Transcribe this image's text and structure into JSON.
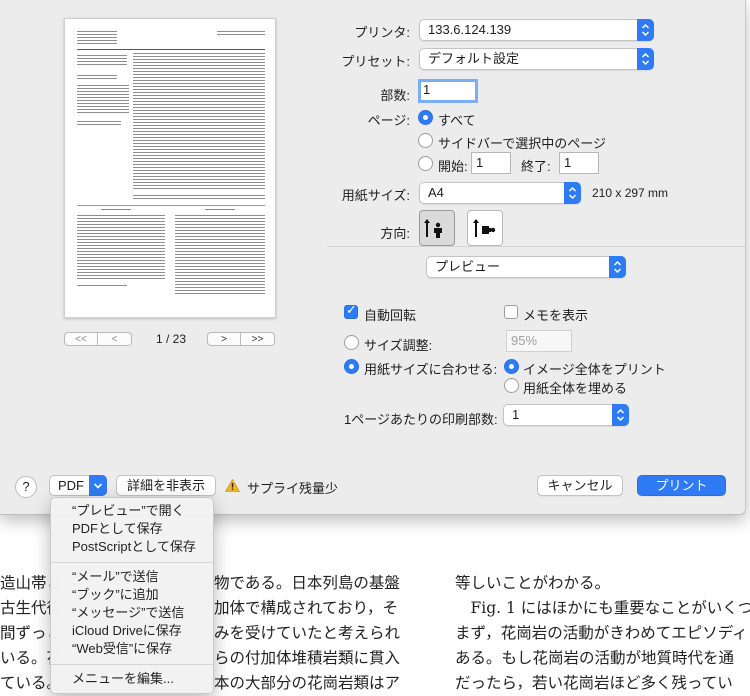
{
  "preview": {
    "page_indicator": "1 / 23",
    "nav_first": "<<",
    "nav_prev": "<",
    "nav_next": ">",
    "nav_last": ">>"
  },
  "printer": {
    "label": "プリンタ:",
    "value": "133.6.124.139"
  },
  "preset": {
    "label": "プリセット:",
    "value": "デフォルト設定"
  },
  "copies": {
    "label": "部数:",
    "value": "1"
  },
  "pages": {
    "label": "ページ:",
    "all": "すべて",
    "sidebar": "サイドバーで選択中のページ",
    "from_label": "開始:",
    "from_value": "1",
    "to_label": "終了:",
    "to_value": "1"
  },
  "paper": {
    "label": "用紙サイズ:",
    "value": "A4",
    "dims": "210 x 297 mm"
  },
  "orientation": {
    "label": "方向:"
  },
  "section": {
    "value": "プレビュー"
  },
  "options": {
    "auto_rotate": "自動回転",
    "show_notes": "メモを表示",
    "scale_label": "サイズ調整:",
    "scale_value": "95%",
    "fit_label": "用紙サイズに合わせる:",
    "print_entire": "イメージ全体をプリント",
    "fill_paper": "用紙全体を埋める",
    "per_page_label": "1ページあたりの印刷部数:",
    "per_page_value": "1"
  },
  "footer": {
    "help": "?",
    "pdf": "PDF",
    "hide_details": "詳細を非表示",
    "supply_warning": "サプライ残量少",
    "cancel": "キャンセル",
    "print": "プリント"
  },
  "pdf_menu": {
    "group1": [
      "“プレビュー”で開く",
      "PDFとして保存",
      "PostScriptとして保存"
    ],
    "group2": [
      "“メール”で送信",
      "“ブック”に追加",
      "“メッセージ”で送信",
      "iCloud Driveに保存",
      "“Web受信”に保存"
    ],
    "group3": [
      "メニューを編集..."
    ]
  },
  "background_doc": {
    "left_lines": [
      "造山帯と",
      "古生代後",
      "間ずっと",
      "いる。花",
      "ている。"
    ],
    "left_lines2": [
      "物である。日本列島の基盤",
      "加体で構成されており，そ",
      "みを受けていたと考えられ",
      "らの付加体堆積岩類に貫入",
      "本の大部分の花崗岩類はア"
    ],
    "right_lines": [
      "等しいことがわかる。",
      "　Fig. 1 にはほかにも重要なことがいくつ",
      "まず，花崗岩の活動がきわめてエピソディ",
      "ある。もし花崗岩の活動が地質時代を通",
      "だったら，若い花崗岩ほど多く残ってい"
    ]
  },
  "colors": {
    "accent": "#2f7bf5",
    "dialog_bg": "#ececec"
  }
}
